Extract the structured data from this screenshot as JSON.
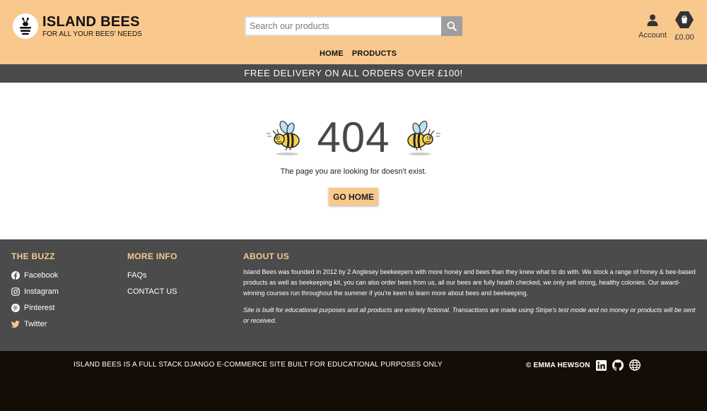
{
  "header": {
    "title": "ISLAND BEES",
    "tagline": "FOR ALL YOUR BEES' NEEDS",
    "search_placeholder": "Search our products",
    "account_label": "Account",
    "bag_label": "£0.00"
  },
  "nav": {
    "items": [
      "HOME",
      "PRODUCTS"
    ]
  },
  "banner": {
    "text": "FREE DELIVERY ON ALL ORDERS OVER £100!"
  },
  "main": {
    "code": "404",
    "message": "The page you are looking for doesn't exist.",
    "button_label": "GO HOME"
  },
  "footer": {
    "buzz": {
      "title": "THE BUZZ",
      "links": [
        {
          "label": "Facebook",
          "icon": "facebook-icon"
        },
        {
          "label": "Instagram",
          "icon": "instagram-icon"
        },
        {
          "label": "Pinterest",
          "icon": "pinterest-icon"
        },
        {
          "label": "Twitter",
          "icon": "twitter-icon"
        }
      ]
    },
    "more_info": {
      "title": "MORE INFO",
      "links": [
        "FAQs",
        "CONTACT US"
      ]
    },
    "about": {
      "title": "ABOUT US",
      "text": "Island Bees was founded in 2012 by 2 Anglesey beekeepers with more honey and bees than they knew what to do with. We stock a range of honey & bee-based products as well as beekeeping kit, you can also order bees from us, all our bees are fully health checked, we only sell strong, healthy colonies. Our award-winning courses run throughout the summer if you're keen to learn more about bees and beekeeping.",
      "note": "Site is built for educational purposes and all products are entirely fictional. Transactions are made using Stripe's test mode and no money or products will be sent or received."
    }
  },
  "bottom": {
    "text": "ISLAND BEES IS A FULL STACK DJANGO E-COMMERCE SITE BUILT FOR EDUCATIONAL PURPOSES ONLY",
    "credit": "© EMMA HEWSON",
    "icons": [
      "linkedin-icon",
      "github-icon",
      "globe-icon"
    ]
  },
  "colors": {
    "header_bg": "#f8c88d",
    "banner_bg": "#4b4b4b",
    "footer_bg": "#4b4b4b",
    "bottom_bg": "#140d05",
    "accent": "#f8c88d"
  }
}
